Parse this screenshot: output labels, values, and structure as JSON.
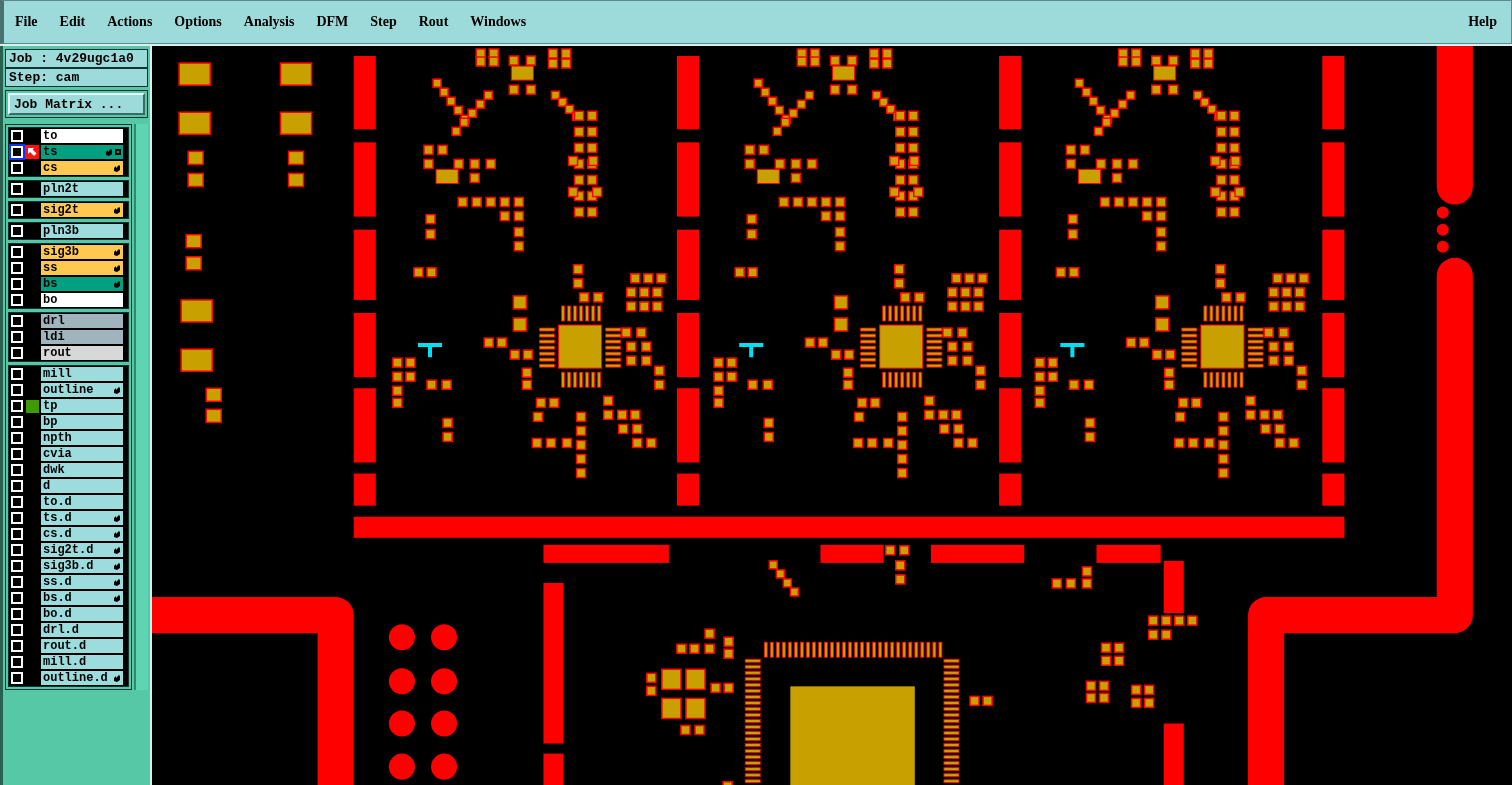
{
  "menu": {
    "items": [
      "File",
      "Edit",
      "Actions",
      "Options",
      "Analysis",
      "DFM",
      "Step",
      "Rout",
      "Windows"
    ],
    "help": "Help"
  },
  "job": {
    "job_label": "Job : 4v29ugc1a0",
    "step_label": "Step: cam",
    "matrix_button": "Job Matrix ..."
  },
  "layer_groups": [
    {
      "layers": [
        {
          "name": "to",
          "color": "#ffffff",
          "checked": false,
          "selected": false,
          "editable": false,
          "affected": false
        },
        {
          "name": "ts",
          "color": "#00a080",
          "checked": false,
          "selected": true,
          "editable": true,
          "affected": false
        },
        {
          "name": "cs",
          "color": "#ffc850",
          "checked": false,
          "selected": false,
          "editable": true,
          "affected": false
        }
      ]
    },
    {
      "layers": [
        {
          "name": "pln2t",
          "color": "#9cdcdc",
          "checked": false,
          "selected": false,
          "editable": false,
          "affected": false
        }
      ]
    },
    {
      "layers": [
        {
          "name": "sig2t",
          "color": "#ffc850",
          "checked": false,
          "selected": false,
          "editable": true,
          "affected": false
        }
      ]
    },
    {
      "layers": [
        {
          "name": "pln3b",
          "color": "#9cdcdc",
          "checked": false,
          "selected": false,
          "editable": false,
          "affected": false
        }
      ]
    },
    {
      "layers": [
        {
          "name": "sig3b",
          "color": "#ffc850",
          "checked": false,
          "selected": false,
          "editable": true,
          "affected": false
        },
        {
          "name": "ss",
          "color": "#ffc850",
          "checked": false,
          "selected": false,
          "editable": true,
          "affected": false
        },
        {
          "name": "bs",
          "color": "#00a080",
          "checked": false,
          "selected": false,
          "editable": true,
          "affected": false
        },
        {
          "name": "bo",
          "color": "#ffffff",
          "checked": false,
          "selected": false,
          "editable": false,
          "affected": false
        }
      ]
    },
    {
      "layers": [
        {
          "name": "drl",
          "color": "#9fb4bc",
          "checked": false,
          "selected": false,
          "editable": false,
          "affected": false
        },
        {
          "name": "ldi",
          "color": "#9fb4bc",
          "checked": false,
          "selected": false,
          "editable": false,
          "affected": false
        },
        {
          "name": "rout",
          "color": "#d8d8d8",
          "checked": false,
          "selected": false,
          "editable": false,
          "affected": false
        }
      ]
    },
    {
      "layers": [
        {
          "name": "mill",
          "color": "#9cdcdc",
          "checked": false,
          "selected": false,
          "editable": false,
          "affected": false
        },
        {
          "name": "outline",
          "color": "#9cdcdc",
          "checked": false,
          "selected": false,
          "editable": true,
          "affected": false
        },
        {
          "name": "tp",
          "color": "#9cdcdc",
          "checked": false,
          "selected": false,
          "editable": false,
          "affected": true
        },
        {
          "name": "bp",
          "color": "#9cdcdc",
          "checked": false,
          "selected": false,
          "editable": false,
          "affected": false
        },
        {
          "name": "npth",
          "color": "#9cdcdc",
          "checked": false,
          "selected": false,
          "editable": false,
          "affected": false
        },
        {
          "name": "cvia",
          "color": "#9cdcdc",
          "checked": false,
          "selected": false,
          "editable": false,
          "affected": false
        },
        {
          "name": "dwk",
          "color": "#9cdcdc",
          "checked": false,
          "selected": false,
          "editable": false,
          "affected": false
        },
        {
          "name": "d",
          "color": "#9cdcdc",
          "checked": false,
          "selected": false,
          "editable": false,
          "affected": false
        },
        {
          "name": "to.d",
          "color": "#9cdcdc",
          "checked": false,
          "selected": false,
          "editable": false,
          "affected": false
        },
        {
          "name": "ts.d",
          "color": "#9cdcdc",
          "checked": false,
          "selected": false,
          "editable": true,
          "affected": false
        },
        {
          "name": "cs.d",
          "color": "#9cdcdc",
          "checked": false,
          "selected": false,
          "editable": true,
          "affected": false
        },
        {
          "name": "sig2t.d",
          "color": "#9cdcdc",
          "checked": false,
          "selected": false,
          "editable": true,
          "affected": false
        },
        {
          "name": "sig3b.d",
          "color": "#9cdcdc",
          "checked": false,
          "selected": false,
          "editable": true,
          "affected": false
        },
        {
          "name": "ss.d",
          "color": "#9cdcdc",
          "checked": false,
          "selected": false,
          "editable": true,
          "affected": false
        },
        {
          "name": "bs.d",
          "color": "#9cdcdc",
          "checked": false,
          "selected": false,
          "editable": true,
          "affected": false
        },
        {
          "name": "bo.d",
          "color": "#9cdcdc",
          "checked": false,
          "selected": false,
          "editable": false,
          "affected": false
        },
        {
          "name": "drl.d",
          "color": "#9cdcdc",
          "checked": false,
          "selected": false,
          "editable": false,
          "affected": false
        },
        {
          "name": "rout.d",
          "color": "#9cdcdc",
          "checked": false,
          "selected": false,
          "editable": false,
          "affected": false
        },
        {
          "name": "mill.d",
          "color": "#9cdcdc",
          "checked": false,
          "selected": false,
          "editable": false,
          "affected": false
        },
        {
          "name": "outline.d",
          "color": "#9cdcdc",
          "checked": false,
          "selected": false,
          "editable": true,
          "affected": false
        }
      ]
    }
  ]
}
